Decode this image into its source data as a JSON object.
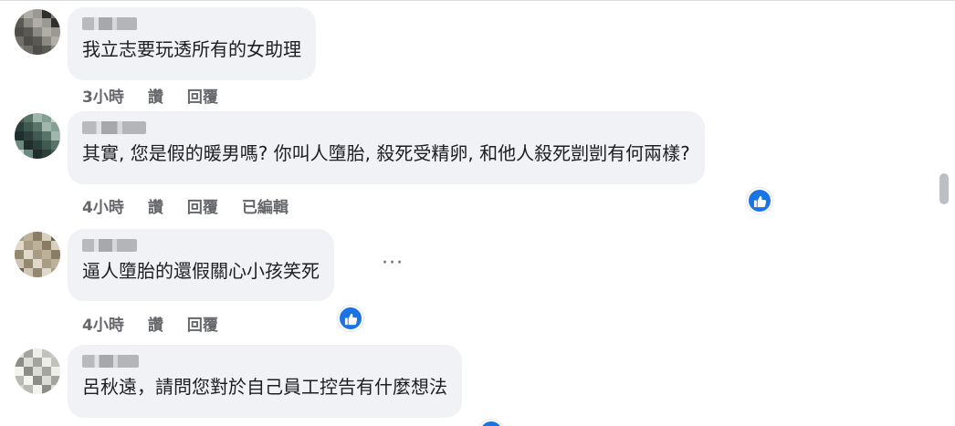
{
  "comments": [
    {
      "text": "我立志要玩透所有的女助理",
      "time": "3小時",
      "like_label": "讚",
      "reply_label": "回覆",
      "edited_label": "",
      "avatar_colors": [
        "#8a8a82",
        "#6f6f68",
        "#9a9a92",
        "#5a5a55",
        "#7d7d76",
        "#b0aea6",
        "#4e4d49",
        "#2f2f2d"
      ]
    },
    {
      "text": "其實, 您是假的暖男嗎? 你叫人墮胎, 殺死受精卵, 和他人殺死剴剴有何兩樣?",
      "time": "4小時",
      "like_label": "讚",
      "reply_label": "回覆",
      "edited_label": "已編輯",
      "avatar_colors": [
        "#3e5a52",
        "#6d8a7e",
        "#9fb7ad",
        "#2c3f3a",
        "#c7d6cf",
        "#587469",
        "#1f2e2a",
        "#84a094"
      ]
    },
    {
      "text": "逼人墮胎的還假關心小孩笑死",
      "time": "4小時",
      "like_label": "讚",
      "reply_label": "回覆",
      "edited_label": "",
      "avatar_colors": [
        "#a89c86",
        "#cfc6b3",
        "#8a7c64",
        "#e0d9c9",
        "#6e624d",
        "#bdb19a",
        "#958871",
        "#d8d0bd"
      ]
    },
    {
      "text": "呂秋遠，請問您對於自己員工控告有什麼想法",
      "time": "",
      "like_label": "",
      "reply_label": "",
      "edited_label": "",
      "avatar_colors": [
        "#dcdcd8",
        "#b9b9b4",
        "#eeeeea",
        "#8d8d88",
        "#cfcfca",
        "#a4a49f",
        "#f3f3f0",
        "#c2c2bd"
      ]
    }
  ],
  "colors": {
    "bubble": "#f0f2f5",
    "meta_text": "#65676b",
    "like_badge": "#1b74e4"
  },
  "icons": {
    "like_reaction": "thumbs-up-icon",
    "options": "more-options-icon"
  }
}
